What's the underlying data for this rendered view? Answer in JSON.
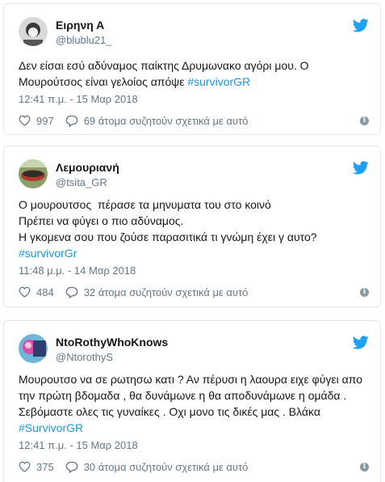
{
  "tweets": [
    {
      "name": "Ειρηνη Α",
      "handle": "@blublu21_",
      "text_plain": "Δεν είσαι εσύ αδύναμος παίκτης Δρυμωνακο αγόρι μου. Ο Μουρούτσος είναι γελοίος απόψε ",
      "hashtag": "#survivorGR",
      "time": "12:41 π.μ. - 15 Μαρ 2018",
      "likes": "997",
      "conversation": "69 άτομα συζητούν σχετικά με αυτό"
    },
    {
      "name": "Λεμουριανή",
      "handle": "@tsita_GR",
      "text_plain": "Ο μουρουτσος  πέρασε τα μηνυματα του στο κοινό\nΠρέπει να φύγει ο πιο αδύναμος.\nΗ γκομενα σου που ζούσε παρασιτικά τι γνώμη έχει γ αυτο?\n",
      "hashtag": "#survivorGr",
      "time": "11:48 μ.μ. - 14 Μαρ 2018",
      "likes": "484",
      "conversation": "32 άτομα συζητούν σχετικά με αυτό"
    },
    {
      "name": "NtoRothyWhoKnows",
      "handle": "@NtorothyS",
      "text_plain": "Μουρουτσο να σε ρωτησω κατι ? Αν πέρυσι η λαουρα ειχε φύγει απο την πρώτη βδομαδα , θα δυνάμωνε η θα αποδυνάμωνε η ομάδα . Σεβόμαστε ολες τις γυναίκες . Οχι μονο τις δικές μας . Βλάκα ",
      "hashtag": "#SurvivorGR",
      "time": "12:41 π.μ. - 15 Μαρ 2018",
      "likes": "375",
      "conversation": "30 άτομα συζητούν σχετικά με αυτό"
    }
  ],
  "icons": {
    "bird": "twitter-bird-icon",
    "heart": "heart-icon",
    "reply": "conversation-bubble-icon",
    "info": "info-icon"
  },
  "colors": {
    "link": "#1b95e0",
    "muted": "#657786",
    "border": "#e1e8ed",
    "text": "#14171a"
  },
  "info_glyph": "i"
}
